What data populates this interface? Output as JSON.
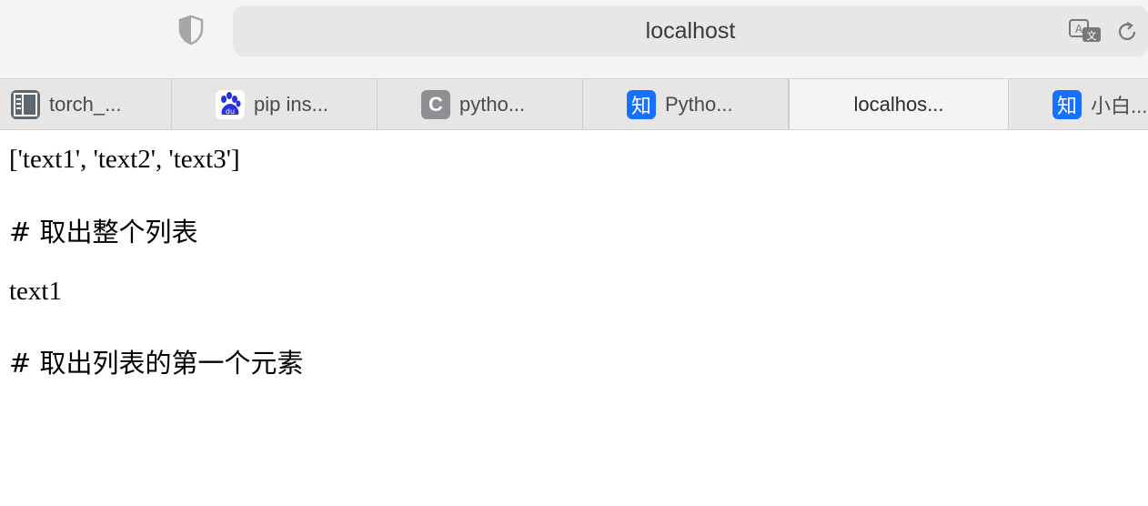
{
  "browser": {
    "address": "localhost",
    "tabs": [
      {
        "label": "torch_...",
        "icon": "sidebar-book-icon"
      },
      {
        "label": "pip ins...",
        "icon": "baidu-paw-icon"
      },
      {
        "label": "pytho...",
        "icon": "c-letter-icon",
        "icon_text": "C"
      },
      {
        "label": "Pytho...",
        "icon": "zhihu-icon",
        "icon_text": "知"
      },
      {
        "label": "localhos...",
        "icon": "",
        "active": true
      },
      {
        "label": "小白...",
        "icon": "zhihu-icon",
        "icon_text": "知"
      }
    ]
  },
  "page": {
    "line1": "['text1', 'text2', 'text3']",
    "line2": "# 取出整个列表",
    "line3": "text1",
    "line4": "# 取出列表的第一个元素"
  }
}
